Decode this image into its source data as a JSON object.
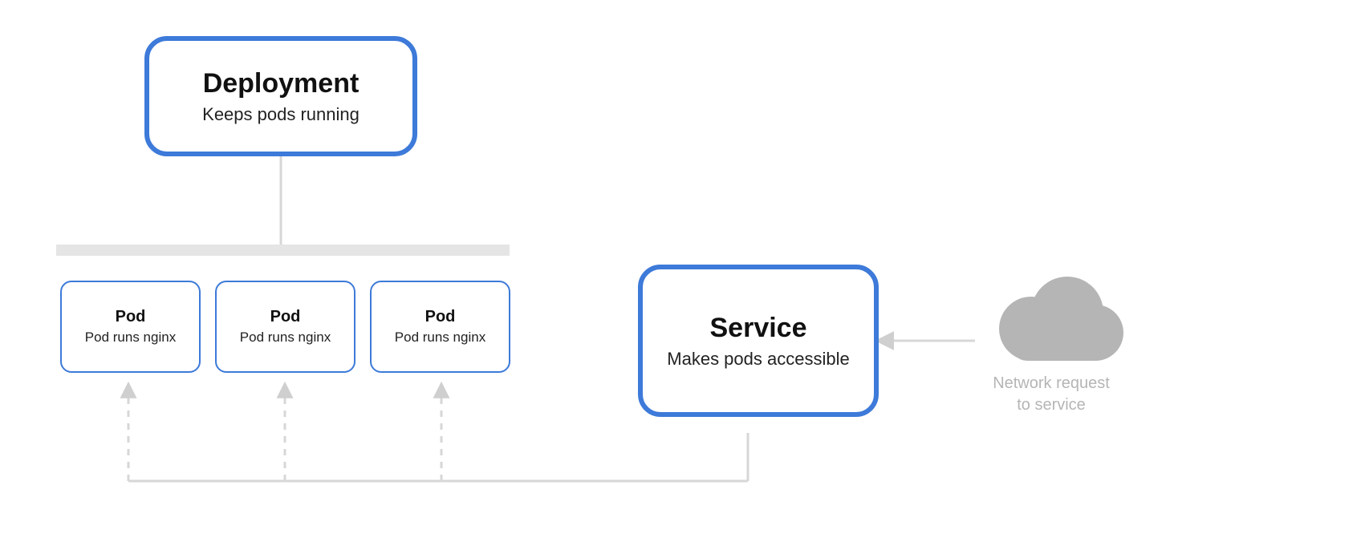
{
  "deployment": {
    "title": "Deployment",
    "subtitle": "Keeps pods running"
  },
  "pods": [
    {
      "title": "Pod",
      "subtitle": "Pod runs nginx"
    },
    {
      "title": "Pod",
      "subtitle": "Pod runs nginx"
    },
    {
      "title": "Pod",
      "subtitle": "Pod runs nginx"
    }
  ],
  "service": {
    "title": "Service",
    "subtitle": "Makes pods accessible"
  },
  "cloud": {
    "caption_line1": "Network request",
    "caption_line2": "to service"
  },
  "colors": {
    "node_border": "#3d7ad9",
    "connector": "#d7d7d7",
    "cloud": "#b5b5b5"
  }
}
